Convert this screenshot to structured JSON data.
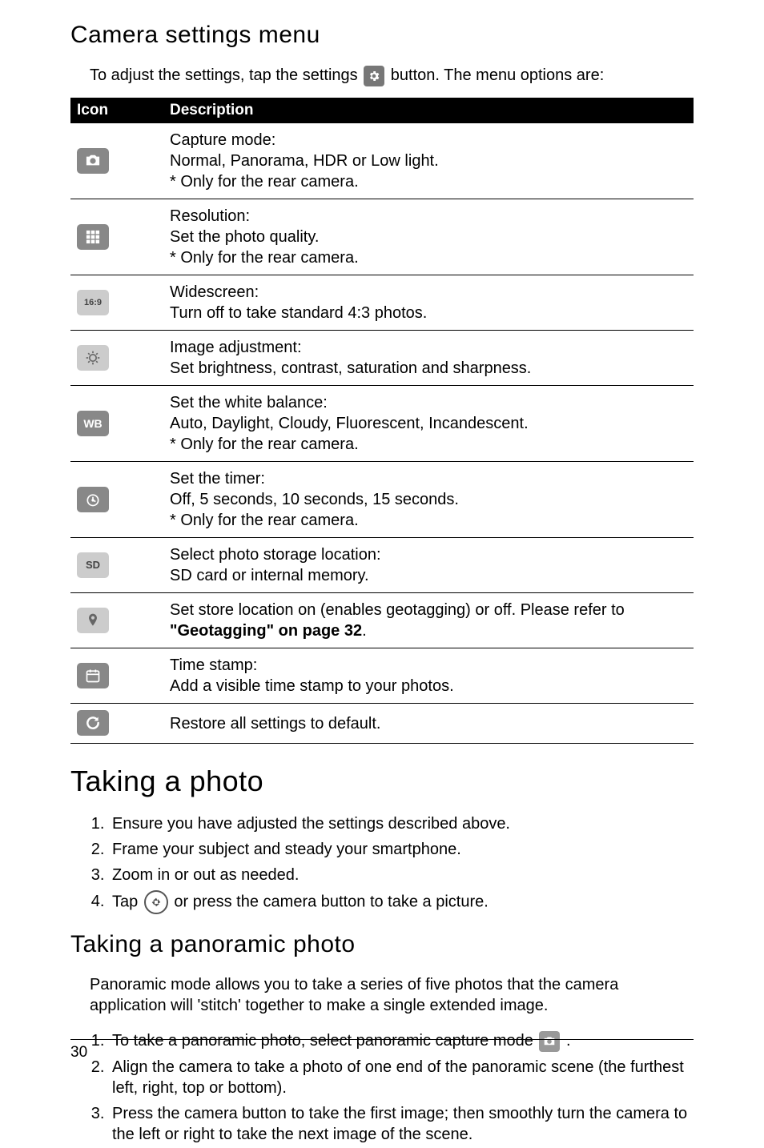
{
  "h_camera_settings": "Camera settings menu",
  "intro_before": "To adjust the settings, tap the settings ",
  "intro_after": " button. The menu options are:",
  "th_icon": "Icon",
  "th_desc": "Description",
  "rows": {
    "r0": {
      "l1": "Capture mode:",
      "l2": "Normal, Panorama, HDR or Low light.",
      "l3": "* Only for the rear camera."
    },
    "r1": {
      "l1": "Resolution:",
      "l2": "Set the photo quality.",
      "l3": "* Only for the rear camera."
    },
    "r2": {
      "l1": "Widescreen:",
      "l2": "Turn off to take standard 4:3 photos."
    },
    "r3": {
      "l1": "Image adjustment:",
      "l2": "Set brightness, contrast, saturation and sharpness."
    },
    "r4": {
      "l1": "Set the white balance:",
      "l2": "Auto, Daylight, Cloudy, Fluorescent, Incandescent.",
      "l3": "* Only for the rear camera."
    },
    "r5": {
      "l1": "Set the timer:",
      "l2": "Off, 5 seconds, 10 seconds, 15 seconds.",
      "l3": "* Only for the rear camera."
    },
    "r6": {
      "l1": "Select photo storage location:",
      "l2": "SD card or internal memory."
    },
    "r7": {
      "pre": "Set store location on (enables geotagging) or off. Please refer to ",
      "bold": "\"Geotagging\" on page 32",
      "post": "."
    },
    "r8": {
      "l1": "Time stamp:",
      "l2": "Add a visible time stamp to your photos."
    },
    "r9": {
      "l1": "Restore all settings to default."
    }
  },
  "icon_labels": {
    "widescreen": "16:9",
    "wb": "WB",
    "sd": "SD"
  },
  "h_taking_photo": "Taking a photo",
  "steps_photo": {
    "s1": "Ensure you have adjusted the settings described above.",
    "s2": "Frame your subject and steady your smartphone.",
    "s3": "Zoom in or out as needed.",
    "s4a": "Tap ",
    "s4b": " or press the camera button to take a picture."
  },
  "h_pano": "Taking a panoramic photo",
  "pano_intro": "Panoramic mode allows you to take a series of five photos that the camera application will 'stitch' together to make a single extended image.",
  "steps_pano": {
    "s1a": "To take a panoramic photo, select panoramic capture mode ",
    "s1b": " .",
    "s2": "Align the camera to take a photo of one end of the panoramic scene (the furthest left, right, top or bottom).",
    "s3": "Press the camera button to take the first image; then smoothly turn the camera to the left or right to take the next image of the scene."
  },
  "page_number": "30"
}
